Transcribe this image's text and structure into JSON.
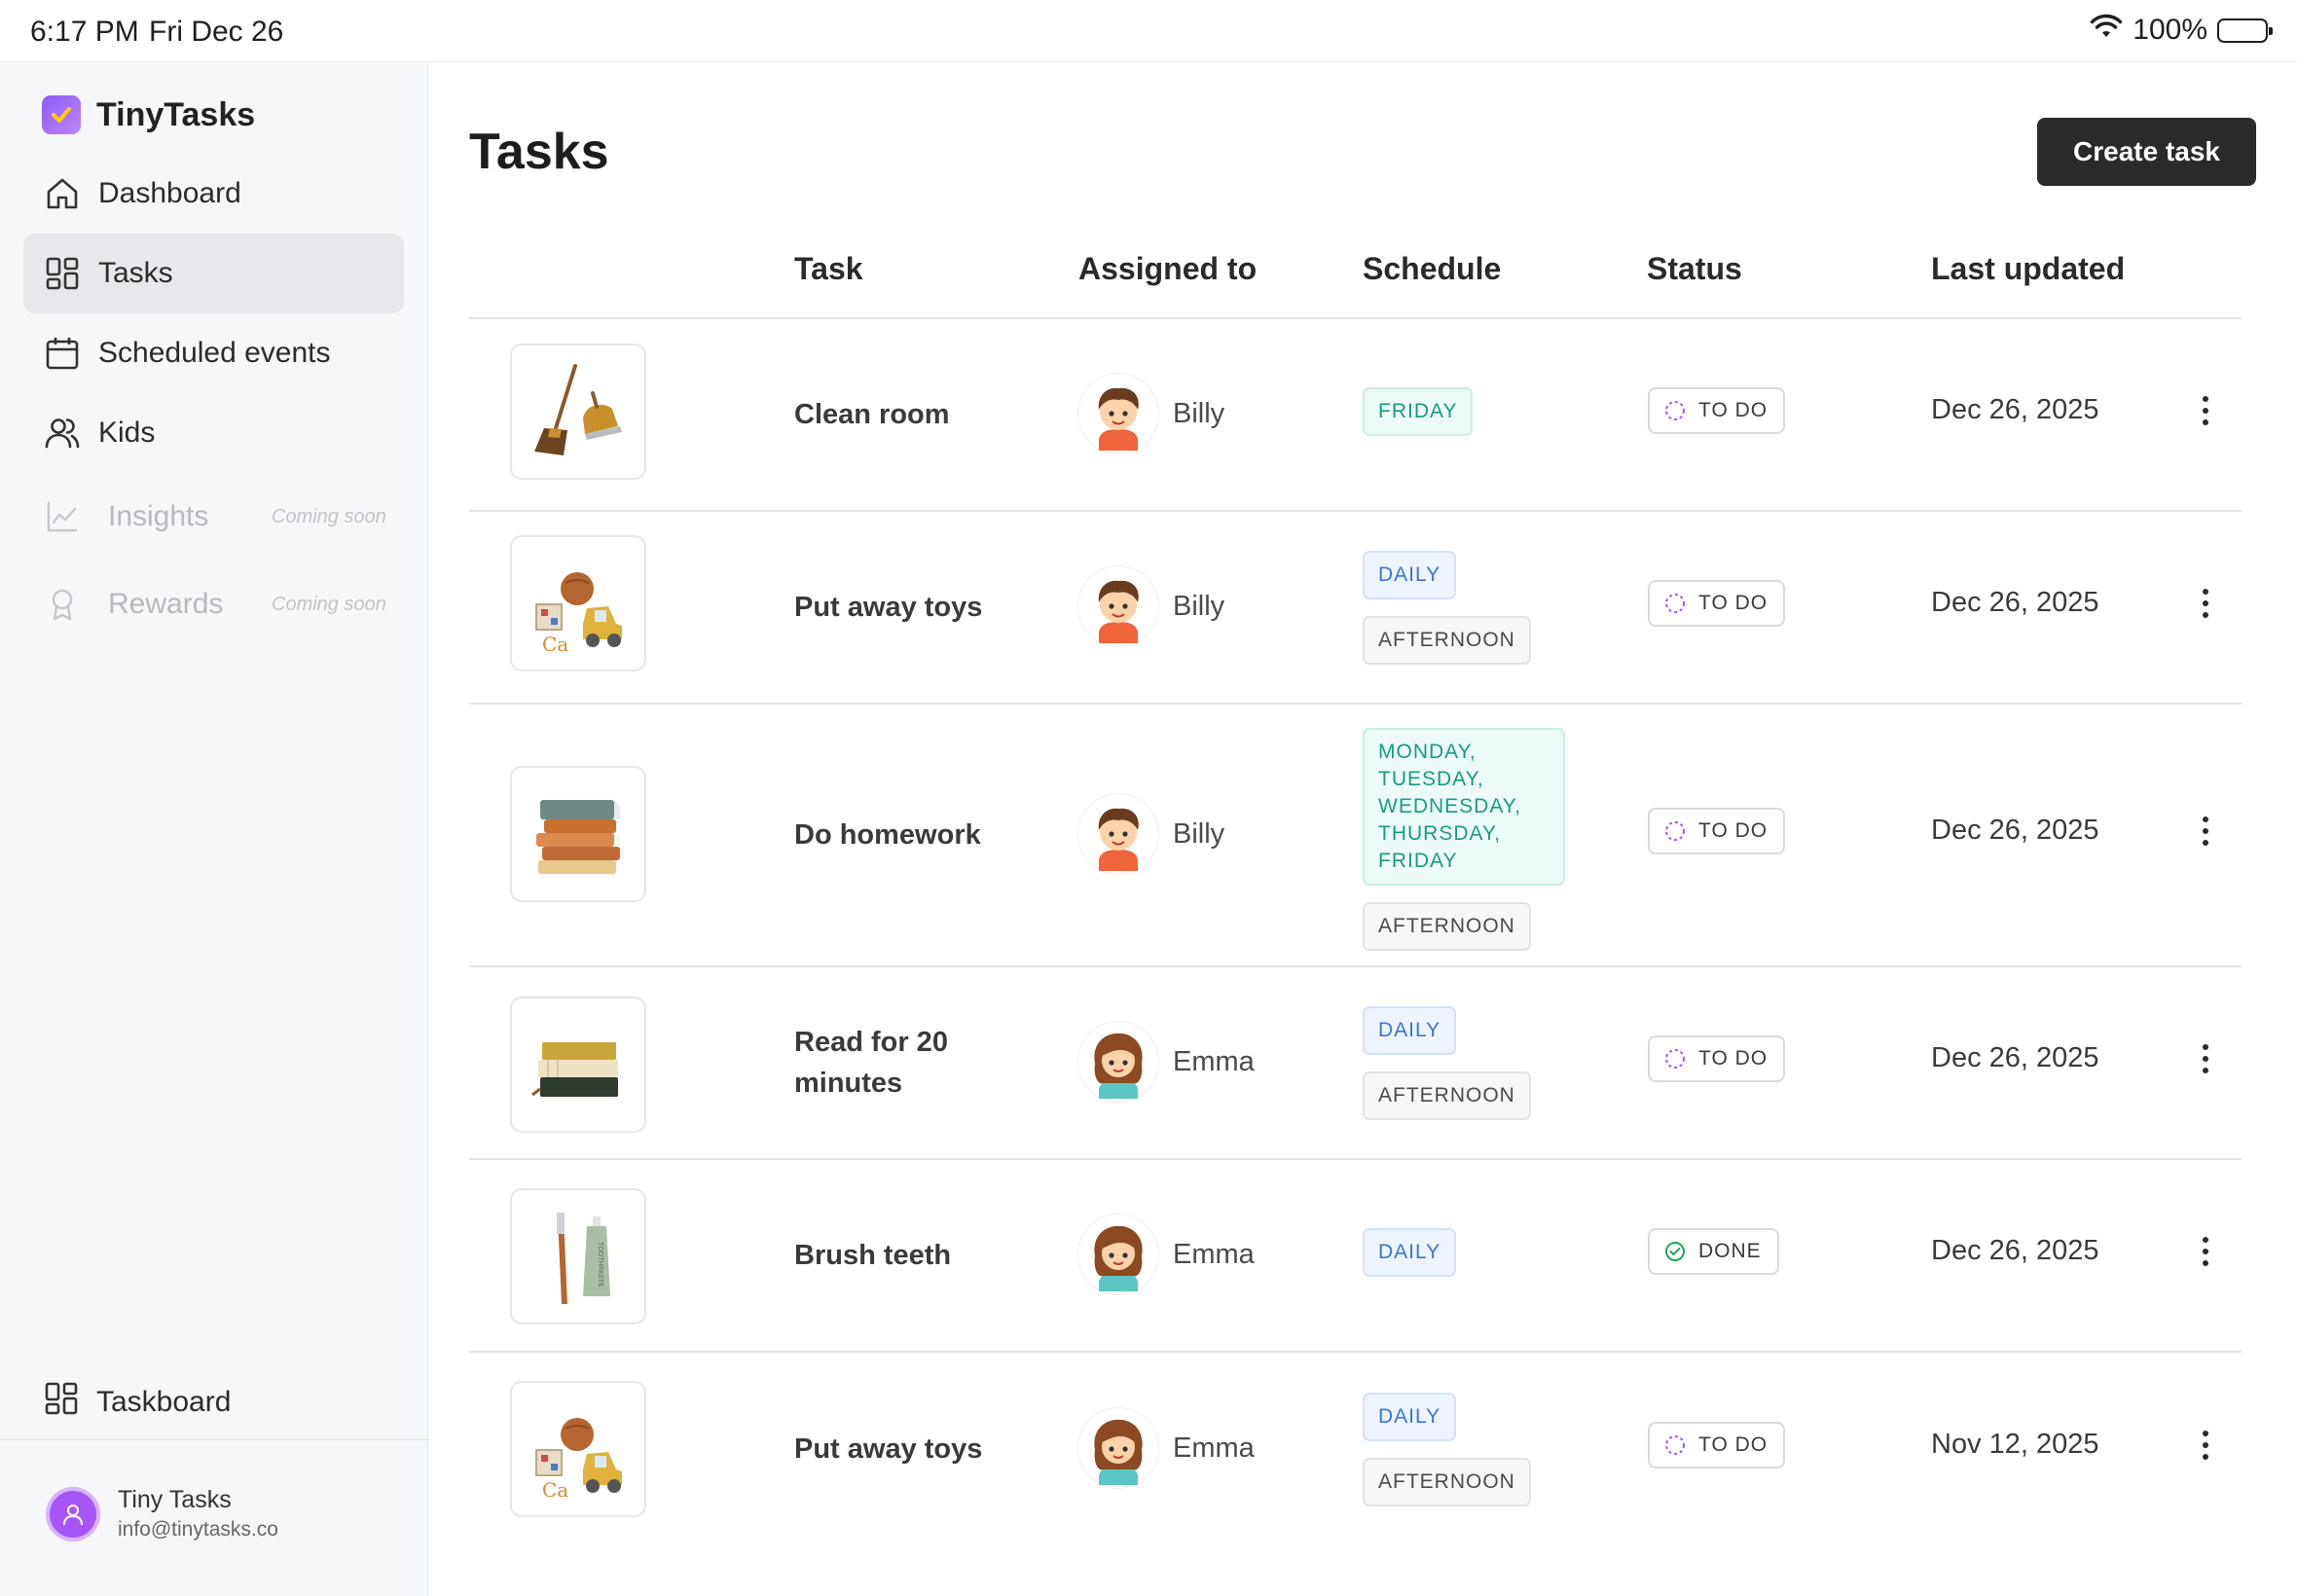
{
  "status_bar": {
    "time": "6:17 PM",
    "date": "Fri Dec 26",
    "battery": "100%"
  },
  "brand": {
    "name": "TinyTasks"
  },
  "sidebar": {
    "items": [
      {
        "label": "Dashboard",
        "icon": "home-icon"
      },
      {
        "label": "Tasks",
        "icon": "grid-icon",
        "active": true
      },
      {
        "label": "Scheduled events",
        "icon": "calendar-icon"
      },
      {
        "label": "Kids",
        "icon": "users-icon"
      },
      {
        "label": "Insights",
        "icon": "chart-icon",
        "note": "Coming soon"
      },
      {
        "label": "Rewards",
        "icon": "award-icon",
        "note": "Coming soon"
      }
    ],
    "bottom": {
      "label": "Taskboard",
      "icon": "grid-icon"
    },
    "user": {
      "name": "Tiny Tasks",
      "email": "info@tinytasks.co"
    }
  },
  "main": {
    "title": "Tasks",
    "create_label": "Create task",
    "columns": [
      "Task",
      "Assigned to",
      "Schedule",
      "Status",
      "Last updated"
    ],
    "rows": [
      {
        "task": "Clean room",
        "thumb": "broom-icon",
        "assignee": "Billy",
        "schedule": [
          "FRIDAY"
        ],
        "status": "TO DO",
        "updated": "Dec 26, 2025"
      },
      {
        "task": "Put away toys",
        "thumb": "toys-icon",
        "assignee": "Billy",
        "schedule": [
          "DAILY",
          "AFTERNOON"
        ],
        "status": "TO DO",
        "updated": "Dec 26, 2025"
      },
      {
        "task": "Do homework",
        "thumb": "books-icon",
        "assignee": "Billy",
        "schedule": [
          "MONDAY,\nTUESDAY,\nWEDNESDAY,\nTHURSDAY,\nFRIDAY",
          "AFTERNOON"
        ],
        "status": "TO DO",
        "updated": "Dec 26, 2025"
      },
      {
        "task": "Read for 20 minutes",
        "thumb": "book-stack-icon",
        "assignee": "Emma",
        "schedule": [
          "DAILY",
          "AFTERNOON"
        ],
        "status": "TO DO",
        "updated": "Dec 26, 2025"
      },
      {
        "task": "Brush teeth",
        "thumb": "toothbrush-icon",
        "assignee": "Emma",
        "schedule": [
          "DAILY"
        ],
        "status": "DONE",
        "updated": "Dec 26, 2025"
      },
      {
        "task": "Put away toys",
        "thumb": "toys-icon",
        "assignee": "Emma",
        "schedule": [
          "DAILY",
          "AFTERNOON"
        ],
        "status": "TO DO",
        "updated": "Nov 12, 2025"
      }
    ]
  },
  "colors": {
    "accent": "#8b5cf6",
    "done": "#22a55b",
    "todo": "#a855f7",
    "button": "#2a2a2a"
  }
}
